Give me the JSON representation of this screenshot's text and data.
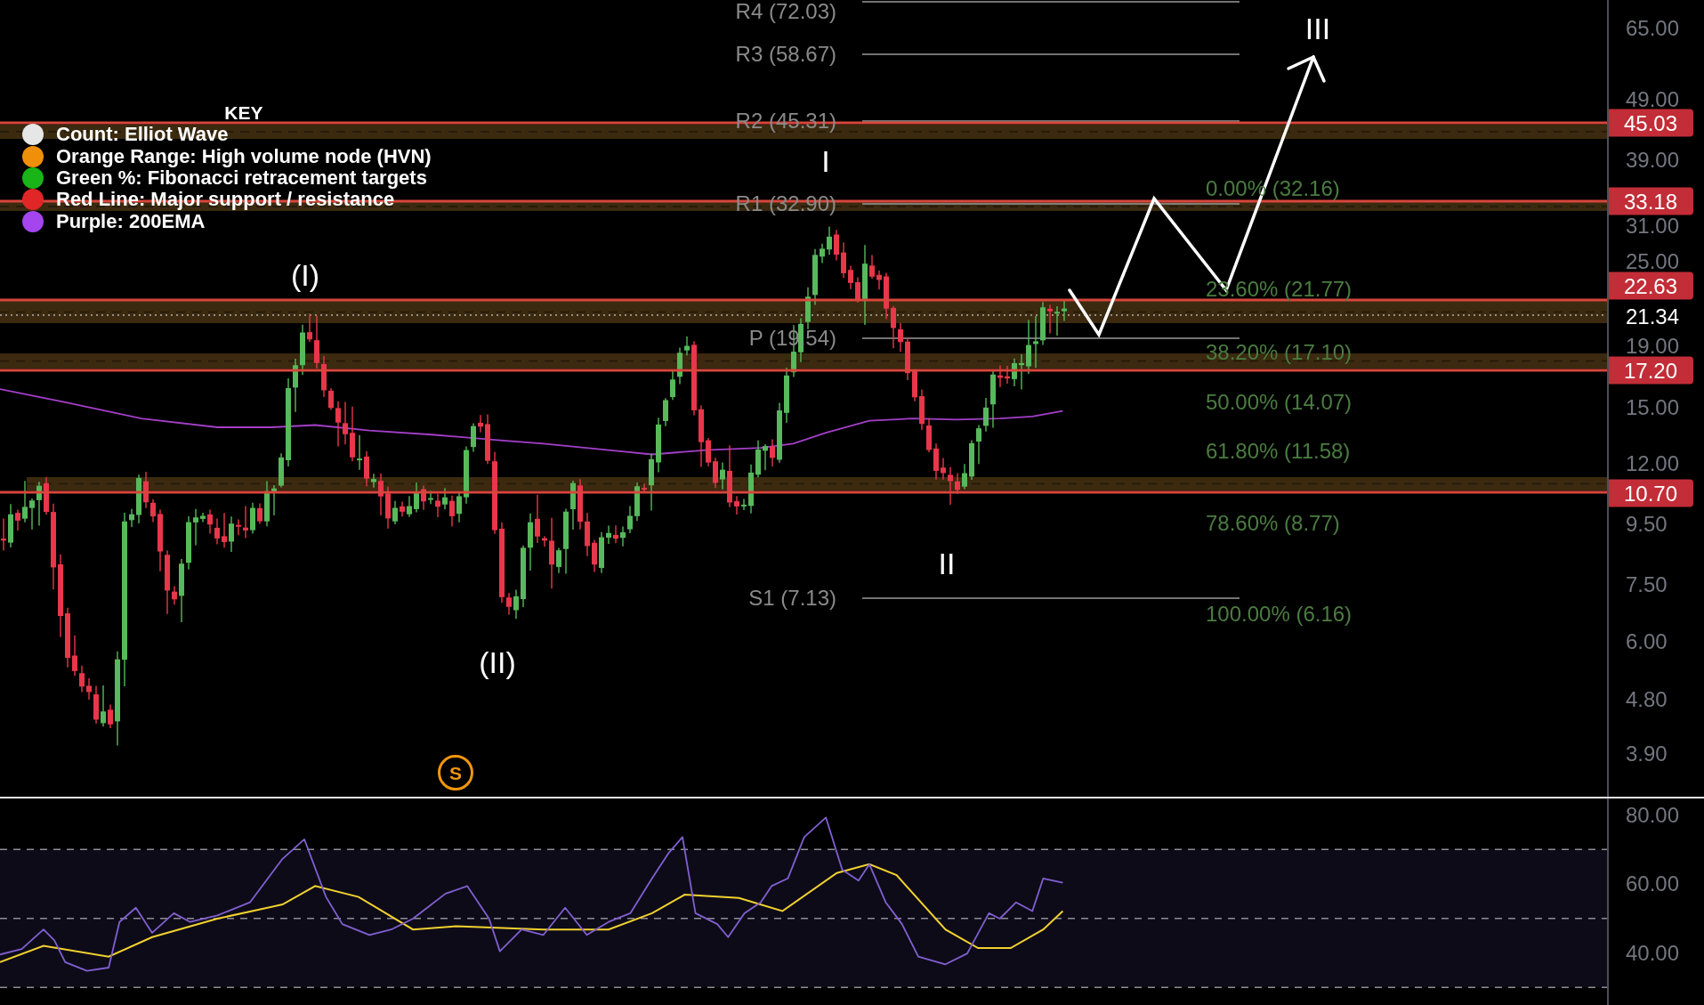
{
  "legend": {
    "title": "KEY",
    "items": [
      {
        "label": "Count: Elliot Wave",
        "color": "#e6e6e6"
      },
      {
        "label": "Orange Range: High volume node (HVN)",
        "color": "#f0900a"
      },
      {
        "label": "Green %: Fibonacci retracement targets",
        "color": "#18b418"
      },
      {
        "label": "Red Line: Major support / resistance",
        "color": "#e02626"
      },
      {
        "label": "Purple: 200EMA",
        "color": "#a445f0"
      }
    ]
  },
  "price_chart": {
    "wave_labels": [
      "(I)",
      "(II)",
      "I",
      "II",
      "III"
    ],
    "pivot_levels": [
      "R4 (72.03)",
      "R3 (58.67)",
      "R2 (45.31)",
      "R1 (32.90)",
      "P (19.54)",
      "S1 (7.13)"
    ],
    "fibonacci_levels": [
      "0.00% (32.16)",
      "23.60% (21.77)",
      "38.20% (17.10)",
      "50.00% (14.07)",
      "61.80% (11.58)",
      "78.60% (8.77)",
      "100.00% (6.16)"
    ],
    "markers": [
      "S"
    ]
  },
  "price_axis": {
    "ticks": [
      "65.00",
      "49.00",
      "39.00",
      "31.00",
      "25.00",
      "19.00",
      "15.00",
      "12.00",
      "9.50",
      "7.50",
      "6.00",
      "4.80",
      "3.90"
    ],
    "levels": [
      "45.03",
      "33.18",
      "22.63",
      "17.20",
      "10.70"
    ],
    "current_price": "21.34"
  },
  "rsi_axis": {
    "ticks": [
      "80.00",
      "60.00",
      "40.00"
    ]
  }
}
